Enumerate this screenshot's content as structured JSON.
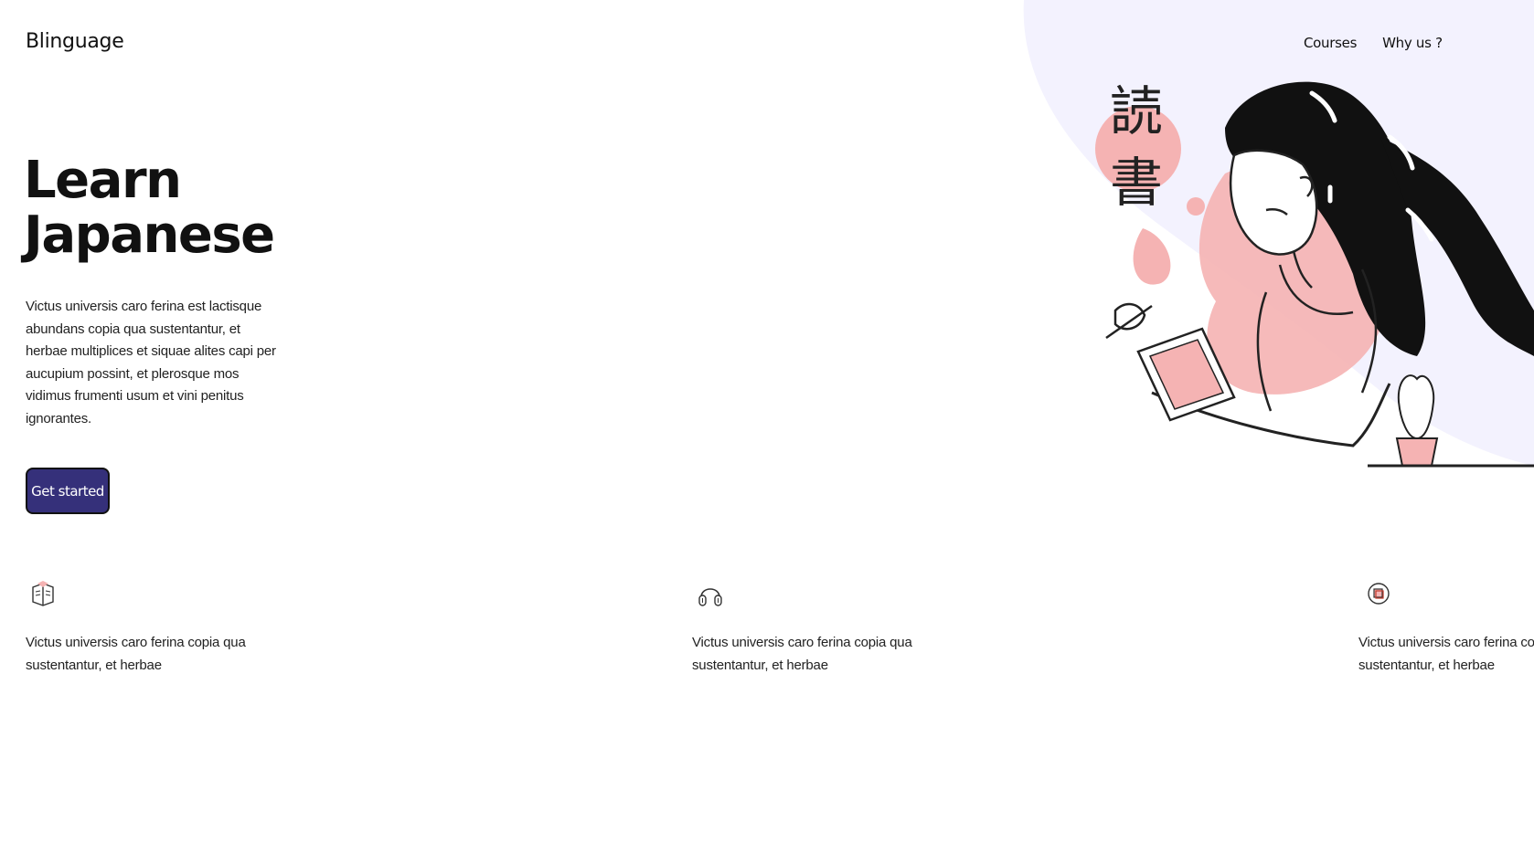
{
  "header": {
    "logo": "Blinguage",
    "nav": [
      {
        "label": "Courses"
      },
      {
        "label": "Why us ?"
      }
    ]
  },
  "hero": {
    "title_line1": "Learn",
    "title_line2": "Japanese",
    "description": "Victus universis caro ferina est lactisque abundans copia qua sustentantur, et herbae multiplices et siquae alites capi per aucupium possint, et plerosque mos vidimus frumenti usum et vini penitus ignorantes.",
    "cta_label": "Get started",
    "illustration_kanji": [
      "読",
      "書"
    ]
  },
  "features": [
    {
      "icon": "book-icon",
      "text": "Victus universis caro ferina copia qua sustentantur, et herbae"
    },
    {
      "icon": "headphones-icon",
      "text": "Victus universis caro ferina copia qua sustentantur, et herbae"
    },
    {
      "icon": "cards-icon",
      "text": "Victus universis caro ferina copia qua sustentantur, et herbae"
    }
  ],
  "colors": {
    "accent": "#35307a",
    "blob": "#f3f2fe",
    "pink": "#f5b3b3",
    "text": "#111111"
  }
}
